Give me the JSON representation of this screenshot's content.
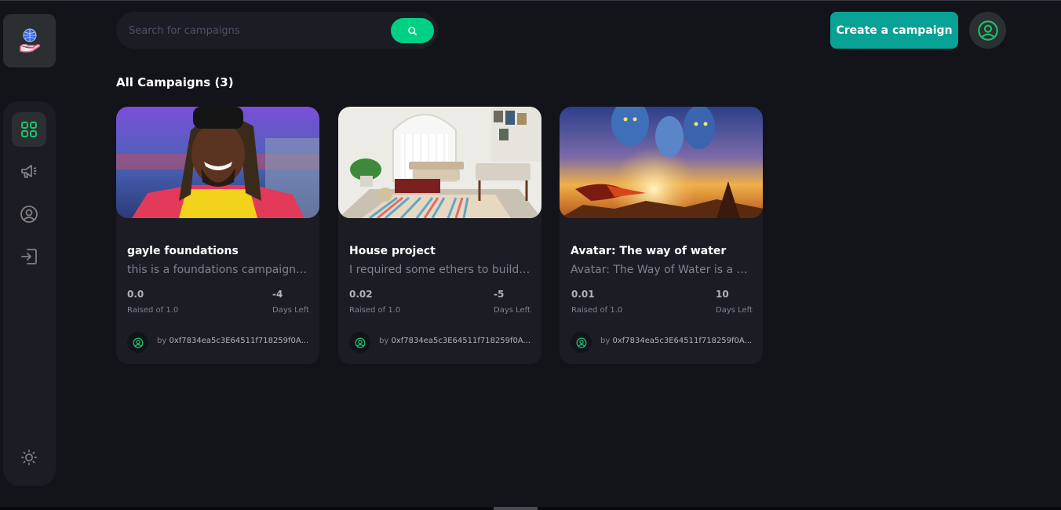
{
  "header": {
    "search_placeholder": "Search for campaigns",
    "create_label": "Create a campaign"
  },
  "sidebar": {
    "logo_icon": "crowdfunding-globe-hand-icon",
    "items": [
      {
        "icon": "dashboard-icon",
        "active": true
      },
      {
        "icon": "campaign-megaphone-icon",
        "active": false
      },
      {
        "icon": "profile-icon",
        "active": false
      },
      {
        "icon": "logout-icon",
        "active": false
      }
    ],
    "theme_icon": "sun-icon"
  },
  "main": {
    "title": "All Campaigns (3)",
    "campaigns": [
      {
        "title": "gayle foundations",
        "description": "this is a foundations campaign t...",
        "raised": "0.0",
        "raised_label": "Raised of 1.0",
        "days": "-4",
        "days_label": "Days Left",
        "by": "by",
        "owner": "0xf7834ea5c3E64511f718259f0A..."
      },
      {
        "title": "House project",
        "description": "I required some ethers to build ...",
        "raised": "0.02",
        "raised_label": "Raised of 1.0",
        "days": "-5",
        "days_label": "Days Left",
        "by": "by",
        "owner": "0xf7834ea5c3E64511f718259f0A..."
      },
      {
        "title": "Avatar: The way of water",
        "description": "Avatar: The Way of Water is a 20...",
        "raised": "0.01",
        "raised_label": "Raised of 1.0",
        "days": "10",
        "days_label": "Days Left",
        "by": "by",
        "owner": "0xf7834ea5c3E64511f718259f0A..."
      }
    ]
  },
  "colors": {
    "background": "#13131a",
    "panel": "#1c1c24",
    "accent_green": "#00d084",
    "create_button": "#07a196",
    "muted_text": "#808191"
  }
}
